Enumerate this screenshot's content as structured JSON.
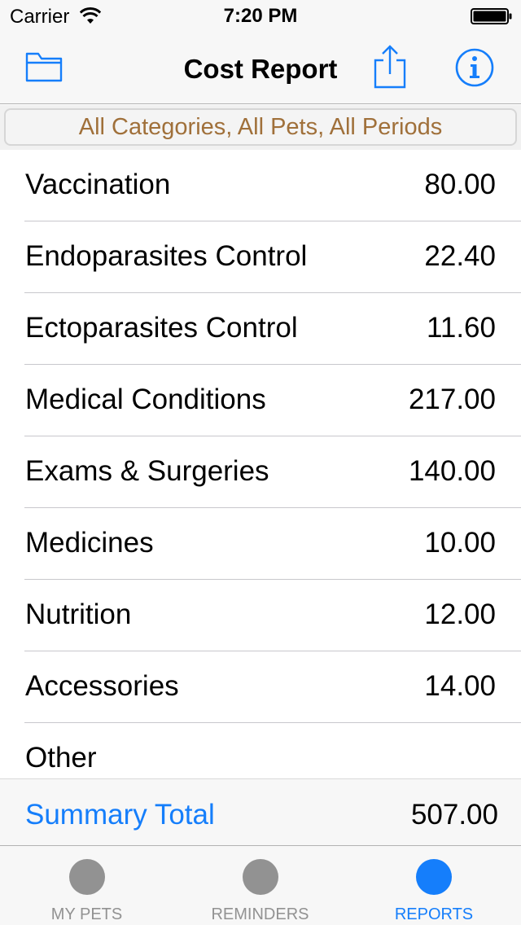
{
  "status_bar": {
    "carrier": "Carrier",
    "time": "7:20 PM"
  },
  "nav": {
    "title": "Cost Report",
    "left_icon": "folder-icon",
    "right_icons": [
      "share-icon",
      "info-icon"
    ]
  },
  "filter": {
    "label": "All Categories, All Pets, All Periods"
  },
  "report": {
    "rows": [
      {
        "label": "Vaccination",
        "value": "80.00"
      },
      {
        "label": "Endoparasites Control",
        "value": "22.40"
      },
      {
        "label": "Ectoparasites Control",
        "value": "11.60"
      },
      {
        "label": "Medical Conditions",
        "value": "217.00"
      },
      {
        "label": "Exams & Surgeries",
        "value": "140.00"
      },
      {
        "label": "Medicines",
        "value": "10.00"
      },
      {
        "label": "Nutrition",
        "value": "12.00"
      },
      {
        "label": "Accessories",
        "value": "14.00"
      },
      {
        "label": "Other",
        "value": ""
      }
    ]
  },
  "summary": {
    "label": "Summary Total",
    "value": "507.00"
  },
  "tabs": [
    {
      "label": "MY PETS",
      "active": false
    },
    {
      "label": "REMINDERS",
      "active": false
    },
    {
      "label": "REPORTS",
      "active": true
    }
  ],
  "colors": {
    "accent": "#157efb",
    "filter_text": "#a0703a",
    "inactive_tab": "#929292"
  }
}
